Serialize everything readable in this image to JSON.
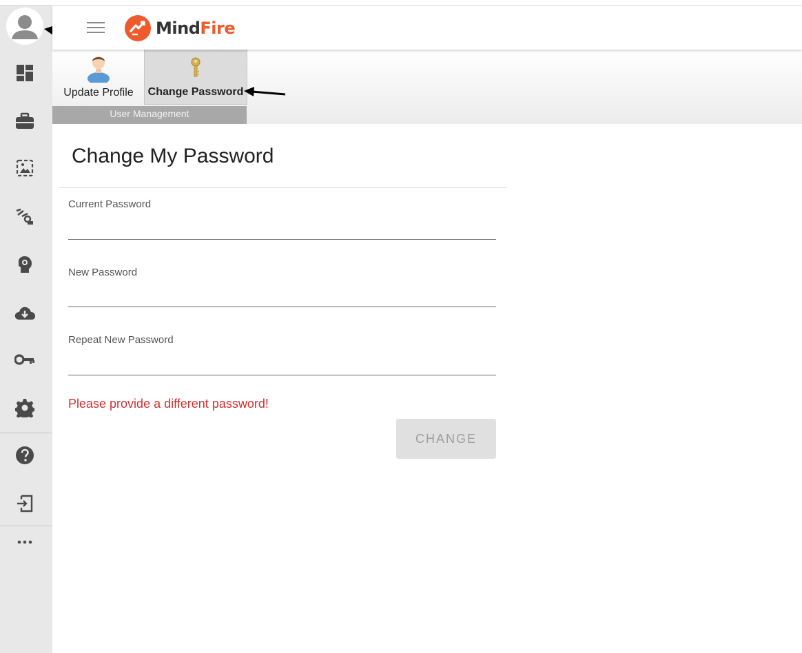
{
  "brand": {
    "name_part1": "Mind",
    "name_part2": "Fire",
    "accent": "#ee5a2b"
  },
  "sidebar": {
    "avatar_icon": "user-avatar-icon",
    "items": [
      {
        "icon": "dashboard-icon"
      },
      {
        "icon": "briefcase-icon"
      },
      {
        "icon": "image-gallery-icon"
      },
      {
        "icon": "hierarchy-icon"
      },
      {
        "icon": "lightbulb-head-icon"
      },
      {
        "icon": "cloud-download-icon"
      },
      {
        "icon": "key-icon"
      },
      {
        "icon": "gear-icon"
      },
      {
        "icon": "help-icon"
      },
      {
        "icon": "logout-icon"
      },
      {
        "icon": "more-icon"
      }
    ]
  },
  "ribbon": {
    "update_profile": "Update Profile",
    "change_password": "Change Password",
    "group_label": "User Management"
  },
  "form": {
    "title": "Change My Password",
    "current_label": "Current Password",
    "new_label": "New Password",
    "repeat_label": "Repeat New Password",
    "error": "Please provide a different password!",
    "submit": "CHANGE",
    "error_color": "#d32f2f"
  }
}
